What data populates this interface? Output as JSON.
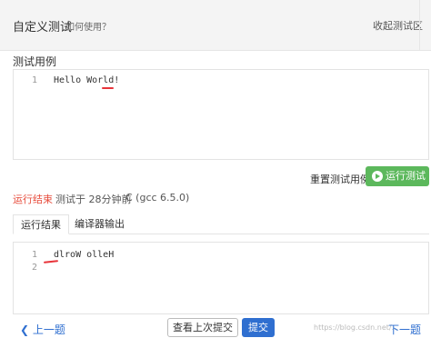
{
  "header": {
    "title": "自定义测试",
    "help_link": "如何使用？",
    "collapse_label": "收起测试区"
  },
  "test_case": {
    "section_label": "测试用例",
    "lines": [
      {
        "no": "1",
        "text": "Hello World!"
      }
    ]
  },
  "actions": {
    "reset_label": "重置测试用例",
    "run_label": "运行测试"
  },
  "status": {
    "result": "运行结束",
    "meta": "测试于 28分钟前",
    "compiler": "C (gcc 6.5.0)"
  },
  "tabs": {
    "run_result": "运行结果",
    "compiler_output": "编译器输出"
  },
  "output": {
    "lines": [
      {
        "no": "1",
        "text": "dlroW olleH"
      },
      {
        "no": "2",
        "text": ""
      }
    ]
  },
  "footer": {
    "prev_label": "上一题",
    "history_label": "查看上次提交",
    "submit_label": "提交",
    "next_label": "下一题",
    "watermark": "https://blog.csdn.net/..."
  },
  "colors": {
    "run_button": "#5cb85c",
    "primary": "#2f6fd0",
    "status_red": "#e74c3c",
    "annotation_red": "#e8343a"
  },
  "icons": {
    "run": "play-circle-icon",
    "prev": "chevron-left-icon",
    "next": "chevron-right-icon"
  }
}
